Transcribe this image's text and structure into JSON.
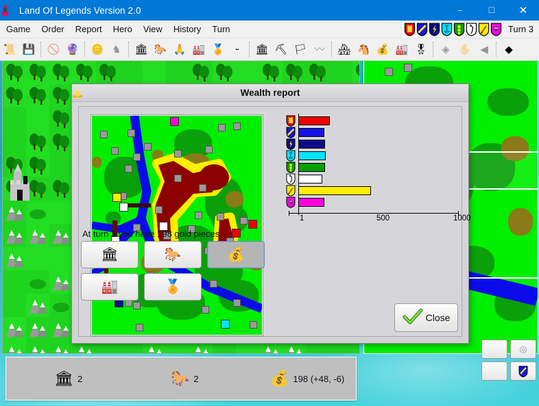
{
  "window": {
    "title": "Land Of Legends Version 2.0",
    "icon": "game-piece-icon",
    "controls": {
      "minimize": "–",
      "maximize": "☐",
      "close": "✕"
    }
  },
  "menubar": {
    "items": [
      {
        "label": "Game"
      },
      {
        "label": "Order"
      },
      {
        "label": "Report"
      },
      {
        "label": "Hero"
      },
      {
        "label": "View"
      },
      {
        "label": "History"
      },
      {
        "label": "Turn"
      }
    ],
    "turn_label": "Turn 3",
    "players": [
      {
        "name": "player-red",
        "color": "#ee0000",
        "emblem": "castle-emblem",
        "selected": true
      },
      {
        "name": "player-blue",
        "color": "#1414e6",
        "emblem": "bend-emblem",
        "selected": false
      },
      {
        "name": "player-navy",
        "color": "#0b0b8c",
        "emblem": "bolt-emblem",
        "selected": false
      },
      {
        "name": "player-cyan",
        "color": "#00e5ff",
        "emblem": "anchor-emblem",
        "selected": false
      },
      {
        "name": "player-green",
        "color": "#00a000",
        "emblem": "tower-emblem",
        "selected": false
      },
      {
        "name": "player-white",
        "color": "#ffffff",
        "emblem": "bird-emblem",
        "selected": false
      },
      {
        "name": "player-yellow",
        "color": "#ffee00",
        "emblem": "sword-emblem",
        "selected": false
      },
      {
        "name": "player-magenta",
        "color": "#ff00dd",
        "emblem": "face-emblem",
        "selected": false
      }
    ]
  },
  "toolbar": {
    "groups": [
      {
        "buttons": [
          {
            "name": "new-game-icon",
            "glyph": "📜",
            "disabled": false
          },
          {
            "name": "save-game-icon",
            "glyph": "💾",
            "disabled": false
          }
        ]
      },
      {
        "buttons": [
          {
            "name": "no-hero-icon",
            "glyph": "🚫",
            "disabled": true
          },
          {
            "name": "magic-icon",
            "glyph": "🔮",
            "disabled": false
          }
        ]
      },
      {
        "buttons": [
          {
            "name": "gold-stack-icon",
            "glyph": "🪙",
            "disabled": false
          },
          {
            "name": "army-grey-icon",
            "glyph": "♞",
            "disabled": true
          }
        ]
      },
      {
        "buttons": [
          {
            "name": "city-icon",
            "glyph": "🏛",
            "disabled": false
          },
          {
            "name": "cavalry-icon",
            "glyph": "🐎",
            "disabled": false
          },
          {
            "name": "hands-icon",
            "glyph": "🙏",
            "disabled": false
          },
          {
            "name": "factory-icon",
            "glyph": "🏭",
            "disabled": false
          },
          {
            "name": "medal-icon",
            "glyph": "🏅",
            "disabled": false
          },
          {
            "name": "smile-icon",
            "glyph": "⏑",
            "disabled": false
          }
        ]
      },
      {
        "buttons": [
          {
            "name": "city-build-icon",
            "glyph": "🏛",
            "disabled": false
          },
          {
            "name": "mine-icon",
            "glyph": "⛏",
            "disabled": false
          },
          {
            "name": "flag-icon",
            "glyph": "🏳",
            "disabled": false
          },
          {
            "name": "wave-icon",
            "glyph": "〰",
            "disabled": true
          }
        ]
      },
      {
        "buttons": [
          {
            "name": "report-city-icon",
            "glyph": "🏘",
            "disabled": false
          },
          {
            "name": "report-army-icon",
            "glyph": "🐴",
            "disabled": false
          },
          {
            "name": "report-gold-icon",
            "glyph": "💰",
            "disabled": false
          },
          {
            "name": "report-factory-icon",
            "glyph": "🏭",
            "disabled": false
          },
          {
            "name": "report-medal-icon",
            "glyph": "🎖",
            "disabled": false
          }
        ]
      },
      {
        "buttons": [
          {
            "name": "eye-icon",
            "glyph": "◈",
            "disabled": true
          },
          {
            "name": "hand-icon",
            "glyph": "✋",
            "disabled": true
          },
          {
            "name": "back-icon",
            "glyph": "◀",
            "disabled": true
          }
        ]
      },
      {
        "buttons": [
          {
            "name": "player-shield-icon",
            "glyph": "◆",
            "disabled": false
          }
        ]
      }
    ]
  },
  "dialog": {
    "title": "Wealth report",
    "icon": "gold-coins-icon",
    "gold_text": "At turn 3 you have 198 gold pieces",
    "close_label": "Close",
    "close_icon": "green-check-icon",
    "report_buttons": [
      {
        "name": "city-report-button",
        "icon": "city-icon",
        "glyph": "🏛",
        "active": false
      },
      {
        "name": "army-report-button",
        "icon": "cavalry-icon",
        "glyph": "🐎",
        "active": false
      },
      {
        "name": "gold-report-button",
        "icon": "gold-icon",
        "glyph": "💰",
        "active": true
      },
      {
        "name": "factory-report-button",
        "icon": "factory-icon",
        "glyph": "🏭",
        "active": false
      },
      {
        "name": "score-report-button",
        "icon": "medal-icon",
        "glyph": "🏅",
        "active": false
      }
    ]
  },
  "chart_data": {
    "type": "bar",
    "title": "Wealth report",
    "orientation": "horizontal",
    "xlabel": "",
    "ylabel": "",
    "xlim": [
      1,
      1000
    ],
    "tick_labels": [
      "1",
      "500",
      "1000"
    ],
    "tick_values": [
      1,
      500,
      1000
    ],
    "grid": false,
    "legend": "player-shield-icons",
    "categories": [
      "player-red",
      "player-blue",
      "player-navy",
      "player-cyan",
      "player-green",
      "player-white",
      "player-yellow",
      "player-magenta"
    ],
    "colors": [
      "#ee0000",
      "#1414e6",
      "#0b0b8c",
      "#00e5ff",
      "#00a000",
      "#ffffff",
      "#ffee00",
      "#ff00dd"
    ],
    "values": [
      198,
      165,
      168,
      172,
      168,
      152,
      455,
      165
    ]
  },
  "statusbar": {
    "items": [
      {
        "name": "city-count",
        "icon": "city-icon",
        "glyph": "🏛",
        "value": "2"
      },
      {
        "name": "army-count",
        "icon": "cavalry-icon",
        "glyph": "🐎",
        "value": "2"
      },
      {
        "name": "gold-amount",
        "icon": "gold-icon",
        "glyph": "💰",
        "value": "198 (+48, -6)"
      }
    ]
  },
  "side_buttons": [
    {
      "name": "coin-toggle-button",
      "glyph": "◎"
    },
    {
      "name": "shield-toggle-button",
      "glyph": "◆"
    }
  ]
}
